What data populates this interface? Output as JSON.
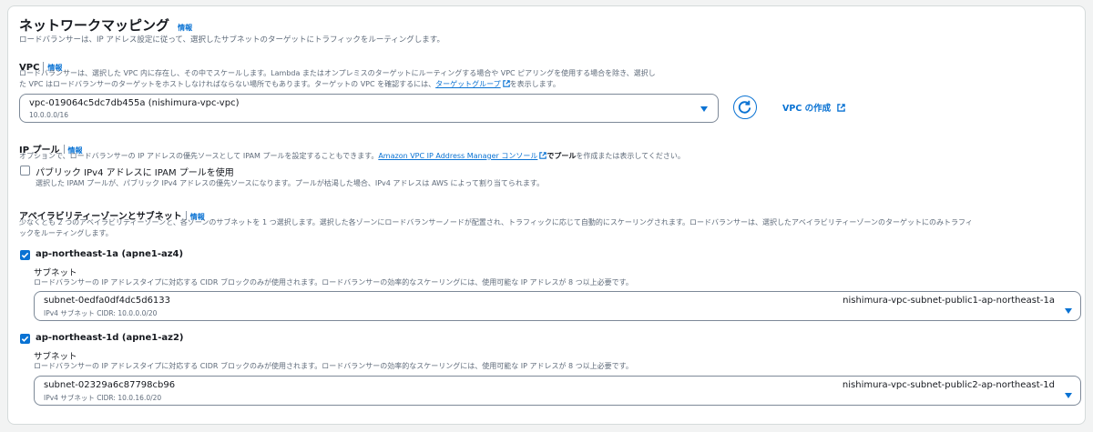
{
  "section": {
    "title": "ネットワークマッピング",
    "info_label": "情報",
    "description": "ロードバランサーは、IP アドレス設定に従って、選択したサブネットのターゲットにトラフィックをルーティングします。"
  },
  "vpc": {
    "label": "VPC",
    "info_label": "情報",
    "description_line1": "ロードバランサーは、選択した VPC 内に存在し、その中でスケールします。Lambda またはオンプレミスのターゲットにルーティングする場合や VPC ピアリングを使用する場合を除き、選択し",
    "description_line2_before": "た VPC はロードバランサーのターゲットをホストしなければならない場所でもあります。ターゲットの VPC を確認するには、",
    "description_link": "ターゲットグループ",
    "description_line2_after": "を表示します。",
    "selected_value": "vpc-019064c5dc7db455a (nishimura-vpc-vpc)",
    "selected_cidr": "10.0.0.0/16",
    "create_link": "VPC の作成"
  },
  "ipam": {
    "label": "IP プール",
    "info_label": "情報",
    "description_before": "オプションで、ロードバランサーの IP アドレスの優先ソースとして IPAM プールを設定することもできます。",
    "description_link": "Amazon VPC IP Address Manager コンソール",
    "description_after_bold": "でプール",
    "description_after": "を作成または表示してください。",
    "checkbox_label": "パブリック IPv4 アドレスに IPAM プールを使用",
    "checkbox_checked": false,
    "checkbox_help": "選択した IPAM プールが、パブリック IPv4 アドレスの優先ソースになります。プールが枯渇した場合、IPv4 アドレスは AWS によって割り当てられます。"
  },
  "az": {
    "label": "アベイラビリティーゾーンとサブネット",
    "info_label": "情報",
    "description_line1": "少なくとも 2 つのアベイラビリティーゾーンと、各ゾーンのサブネットを 1 つ選択します。選択した各ゾーンにロードバランサーノードが配置され、トラフィックに応じて自動的にスケーリングされます。ロードバランサーは、選択したアベイラビリティーゾーンのターゲットにのみトラフィ",
    "description_line2": "ックをルーティングします。",
    "zones": [
      {
        "name": "ap-northeast-1a (apne1-az4)",
        "checked": true,
        "subnet_label": "サブネット",
        "subnet_help": "ロードバランサーの IP アドレスタイプに対応する CIDR ブロックのみが使用されます。ロードバランサーの効率的なスケーリングには、使用可能な IP アドレスが 8 つ以上必要です。",
        "subnet_id": "subnet-0edfa0df4dc5d6133",
        "subnet_cidr": "IPv4 サブネット CIDR: 10.0.0.0/20",
        "subnet_name": "nishimura-vpc-subnet-public1-ap-northeast-1a"
      },
      {
        "name": "ap-northeast-1d (apne1-az2)",
        "checked": true,
        "subnet_label": "サブネット",
        "subnet_help": "ロードバランサーの IP アドレスタイプに対応する CIDR ブロックのみが使用されます。ロードバランサーの効率的なスケーリングには、使用可能な IP アドレスが 8 つ以上必要です。",
        "subnet_id": "subnet-02329a6c87798cb96",
        "subnet_cidr": "IPv4 サブネット CIDR: 10.0.16.0/20",
        "subnet_name": "nishimura-vpc-subnet-public2-ap-northeast-1d"
      }
    ]
  },
  "colors": {
    "accent": "#0972d3",
    "text": "#16191f",
    "muted": "#5f6b7a",
    "border": "#7d8998"
  }
}
